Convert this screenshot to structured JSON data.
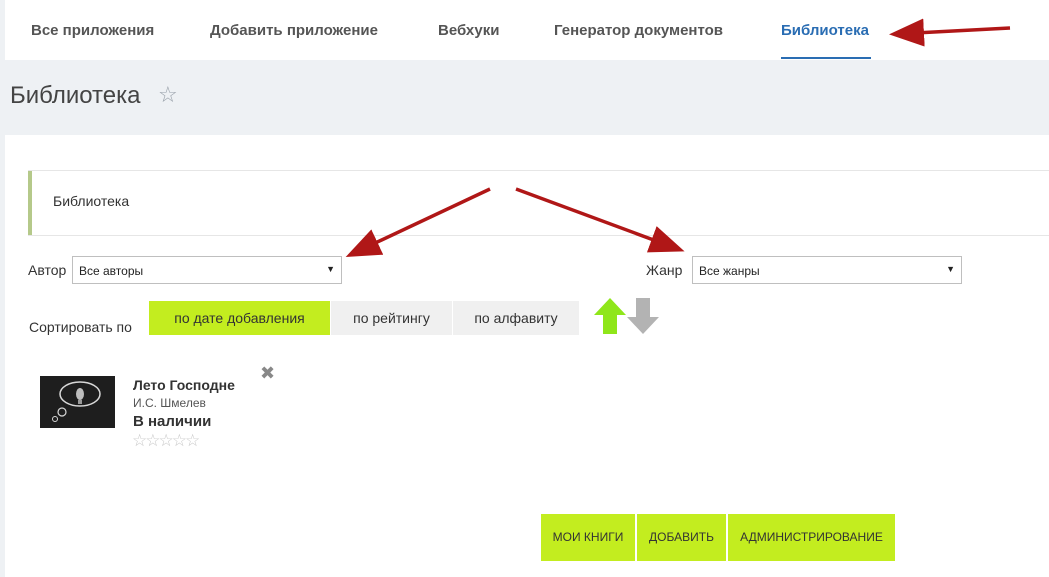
{
  "nav": {
    "tabs": [
      {
        "label": "Все приложения"
      },
      {
        "label": "Добавить приложение"
      },
      {
        "label": "Вебхуки"
      },
      {
        "label": "Генератор документов"
      },
      {
        "label": "Библиотека"
      }
    ],
    "active_tab": "Библиотека"
  },
  "header": {
    "title": "Библиотека",
    "favorite_icon": "star-outline-icon"
  },
  "panel": {
    "title": "Библиотека"
  },
  "filters": {
    "author_label": "Автор",
    "author_value": "Все авторы",
    "genre_label": "Жанр",
    "genre_value": "Все жанры"
  },
  "sort": {
    "label": "Сортировать по",
    "options": [
      "по дате добавления",
      "по рейтингу",
      "по алфавиту"
    ],
    "active": "по дате добавления",
    "direction_icons": [
      "arrow-up-icon",
      "arrow-down-icon"
    ]
  },
  "books": [
    {
      "title": "Лето Господне",
      "author": "И.С. Шмелев",
      "status": "В наличии",
      "rating_stars": 0,
      "max_stars": 5
    }
  ],
  "actions": {
    "my_books": "МОИ КНИГИ",
    "add": "ДОБАВИТЬ",
    "admin": "АДМИНИСТРИРОВАНИЕ"
  },
  "colors": {
    "accent_green": "#c3ed1f",
    "active_tab_blue": "#2a6db3",
    "annotation_red": "#b01717"
  }
}
